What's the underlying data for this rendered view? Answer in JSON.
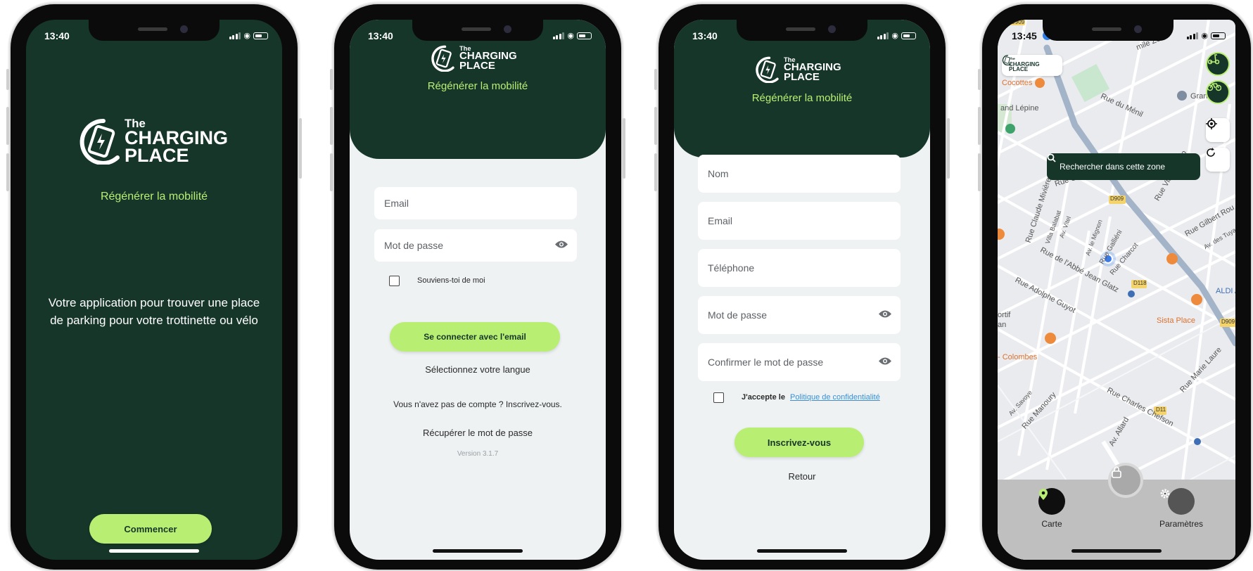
{
  "status": {
    "time_a": "13:40",
    "time_b": "13:45"
  },
  "brand": {
    "the": "The",
    "charging": "CHARGING",
    "place": "PLACE",
    "tagline": "Régénérer la mobilité",
    "accent_color": "#b8ef73",
    "dark_green": "#16362a"
  },
  "welcome": {
    "description_line1": "Votre application pour trouver une place",
    "description_line2": "de parking pour votre trottinette ou vélo",
    "start_button": "Commencer"
  },
  "login": {
    "email_placeholder": "Email",
    "password_placeholder": "Mot de passe",
    "remember_me": "Souviens-toi de moi",
    "login_button": "Se connecter avec l'email",
    "language": "Sélectionnez votre langue",
    "no_account": "Vous n'avez pas de compte ? Inscrivez-vous.",
    "recover_password": "Récupérer le mot de passe",
    "version": "Version 3.1.7"
  },
  "register": {
    "name_placeholder": "Nom",
    "email_placeholder": "Email",
    "phone_placeholder": "Téléphone",
    "password_placeholder": "Mot de passe",
    "confirm_placeholder": "Confirmer le mot de passe",
    "accept_text": "J'accepte le",
    "privacy_link": "Politique de confidentialité",
    "register_button": "Inscrivez-vous",
    "back": "Retour"
  },
  "map": {
    "search_zone": "Rechercher dans cette zone",
    "tab_map": "Carte",
    "tab_settings": "Paramètres",
    "labels": {
      "l1": "mile Zola",
      "l2": "Cocottes",
      "l3": "Rue du Ménil",
      "l4": "Grande M",
      "l5": "Rue Gramme",
      "l6": "Rue Claude Mivière",
      "l7": "Rue Victor Hugo",
      "l8": "Rue Gilbert Rou",
      "l9": "Av. des Tuyas",
      "l10": "Rue Galliéni",
      "l11": "Rue Charcot",
      "l12": "Rue de l'Abbé Jean Glatz",
      "l13": "Rue Adolphe Guyot",
      "l14": "ALDI A",
      "l15": "Sista Place",
      "l16": "ortif",
      "l17": "an",
      "l18": "- Colombes",
      "l19": "Rue Marie Laure",
      "l20": "Rue Charles Chefson",
      "l21": "Rue Manoury",
      "l22": "Av. Allard",
      "l23": "Av. Savoye",
      "l24": "Av. le Mignon",
      "l25": "Av. Vitel",
      "l26": "Villa Balabat",
      "l27": "D909",
      "l28": "D118",
      "l29": "D11",
      "l30": "D909",
      "l31": "and Lépine",
      "l32": "D909"
    }
  }
}
